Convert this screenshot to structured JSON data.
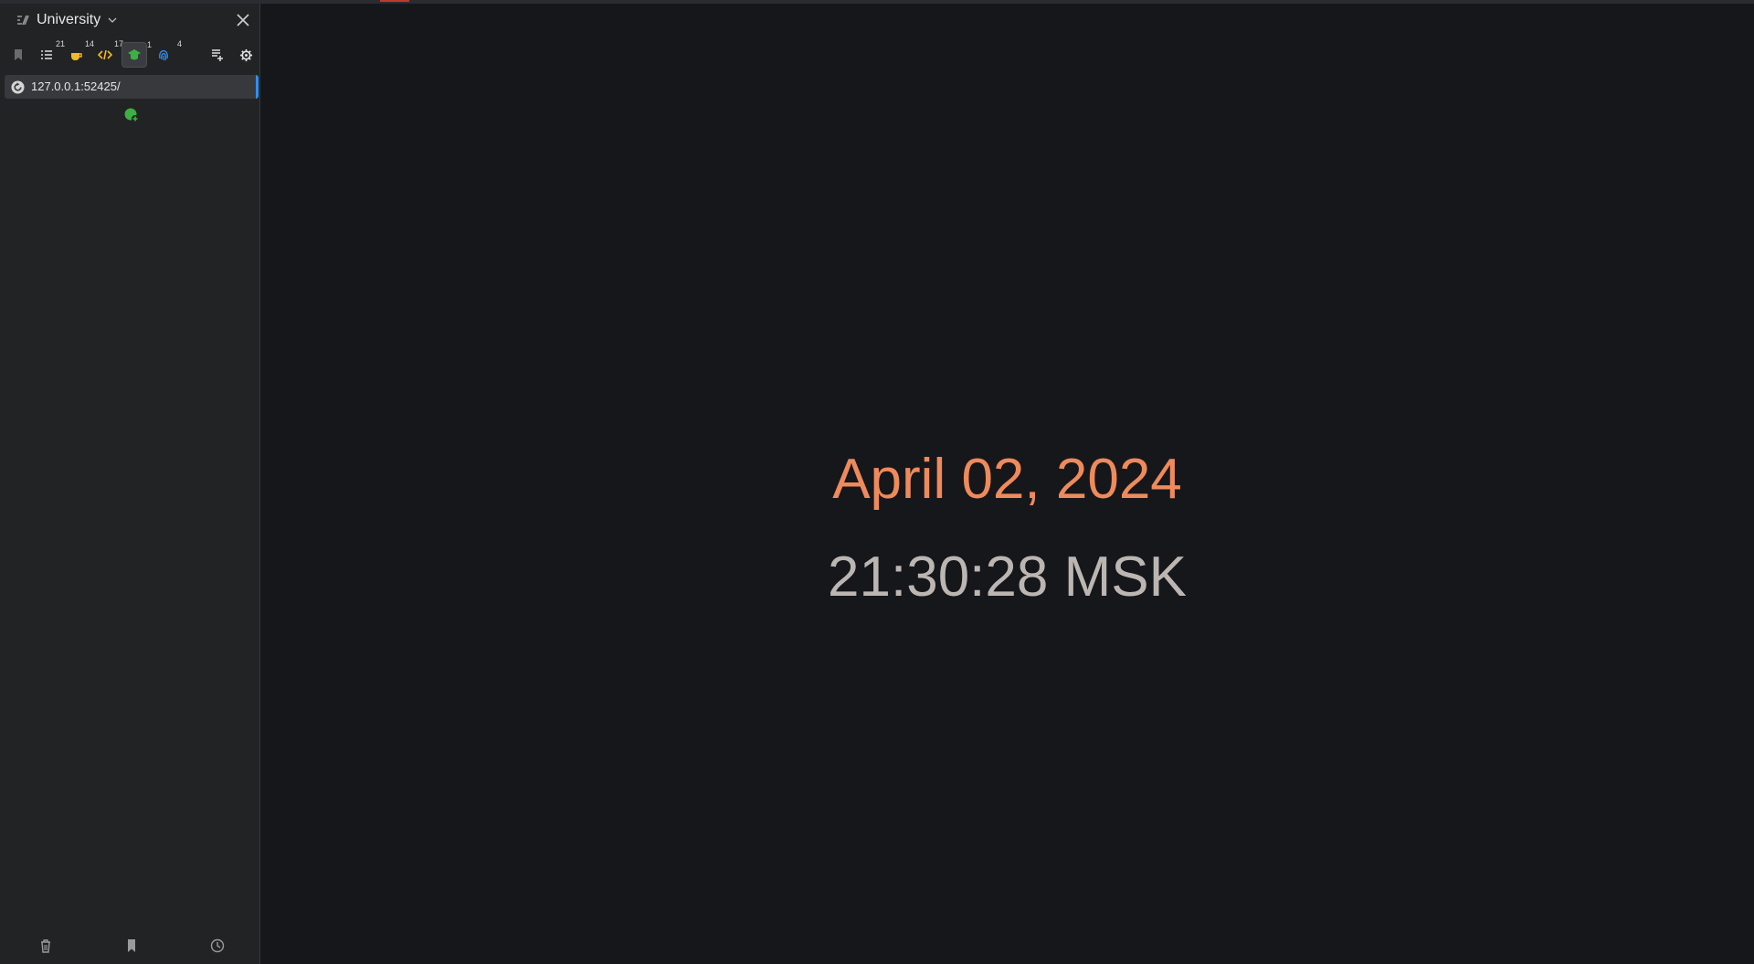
{
  "workspace": {
    "title": "University",
    "icon": "workspace-icon"
  },
  "toolbar": {
    "buttons": [
      {
        "name": "bookmark-icon",
        "count": ""
      },
      {
        "name": "list-icon",
        "count": "21"
      },
      {
        "name": "coffee-icon",
        "count": "14"
      },
      {
        "name": "code-icon",
        "count": "17"
      },
      {
        "name": "graduation-cap-icon",
        "count": "1"
      },
      {
        "name": "fingerprint-icon",
        "count": "4"
      },
      {
        "name": "add-list-icon",
        "count": ""
      },
      {
        "name": "gear-icon",
        "count": ""
      }
    ]
  },
  "tabs": [
    {
      "url": "127.0.0.1:52425/"
    }
  ],
  "main": {
    "date": "April 02, 2024",
    "time": "21:30:28 MSK"
  },
  "colors": {
    "date": "#ee8a5b",
    "time": "#bcb6b2",
    "accent": "#2f8ff2",
    "green": "#3cb043"
  }
}
